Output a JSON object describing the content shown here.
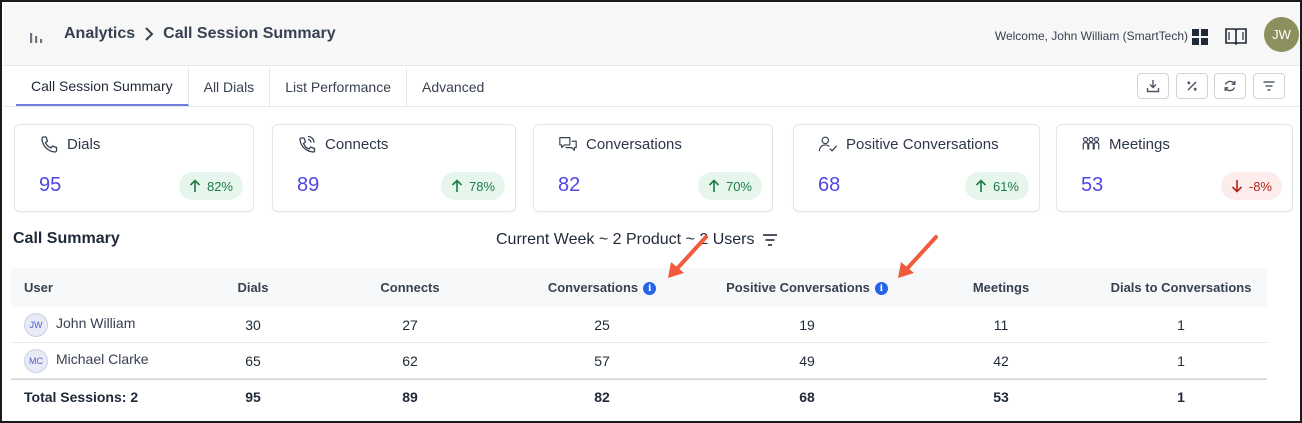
{
  "header": {
    "breadcrumb": [
      "Analytics",
      "Call Session Summary"
    ],
    "welcome_text": "Welcome, John William (SmartTech)",
    "avatar_initials": "JW",
    "icons": [
      "bar-chart-icon",
      "chevron-right-icon",
      "grid-icon",
      "book-icon"
    ]
  },
  "tabs": [
    {
      "label": "Call Session Summary",
      "active": true
    },
    {
      "label": "All Dials",
      "active": false
    },
    {
      "label": "List Performance",
      "active": false
    },
    {
      "label": "Advanced",
      "active": false
    }
  ],
  "toolbar": {
    "icons": [
      "download-icon",
      "percent-icon",
      "refresh-icon",
      "filter-icon"
    ]
  },
  "kpis": [
    {
      "label": "Dials",
      "icon": "phone-icon",
      "value": "95",
      "change": "82%",
      "trend": "up"
    },
    {
      "label": "Connects",
      "icon": "phone-connect-icon",
      "value": "89",
      "change": "78%",
      "trend": "up"
    },
    {
      "label": "Conversations",
      "icon": "chat-bubbles-icon",
      "value": "82",
      "change": "70%",
      "trend": "up"
    },
    {
      "label": "Positive Conversations",
      "icon": "user-check-icon",
      "value": "68",
      "change": "61%",
      "trend": "up"
    },
    {
      "label": "Meetings",
      "icon": "group-icon",
      "value": "53",
      "change": "-8%",
      "trend": "down"
    }
  ],
  "colors": {
    "accent_value": "#4f46e5",
    "trend_up_bg": "#e6f6ec",
    "trend_up_text": "#1f7a46",
    "trend_down_bg": "#fdecec",
    "trend_down_text": "#b42318",
    "info_icon": "#2563eb",
    "annotation_arrow": "#f05a3d"
  },
  "summary": {
    "title": "Call Summary",
    "filter_text": "Current Week ~ 2 Product ~ 2 Users",
    "columns": [
      "User",
      "Dials",
      "Connects",
      "Conversations",
      "Positive Conversations",
      "Meetings",
      "Dials to Conversations"
    ],
    "rows": [
      {
        "initials": "JW",
        "user": "John William",
        "dials": "30",
        "connects": "27",
        "conversations": "25",
        "positive": "19",
        "meetings": "11",
        "dtc": "1"
      },
      {
        "initials": "MC",
        "user": "Michael Clarke",
        "dials": "65",
        "connects": "62",
        "conversations": "57",
        "positive": "49",
        "meetings": "42",
        "dtc": "1"
      }
    ],
    "total": {
      "label": "Total Sessions: 2",
      "dials": "95",
      "connects": "89",
      "conversations": "82",
      "positive": "68",
      "meetings": "53",
      "dtc": "1"
    }
  }
}
